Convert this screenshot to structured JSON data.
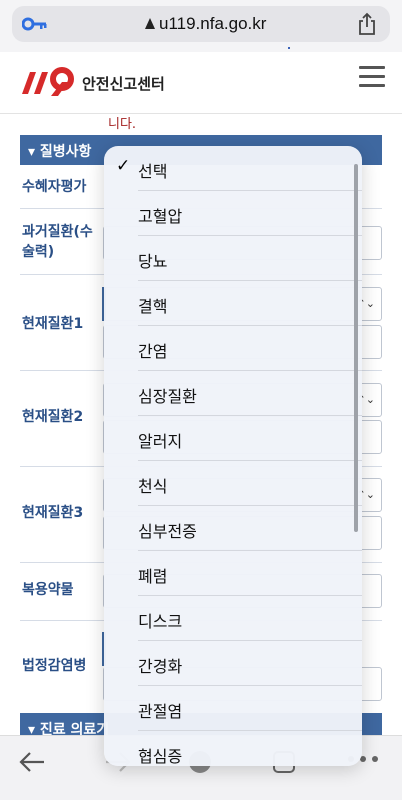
{
  "browser": {
    "url": "u119.nfa.go.kr"
  },
  "site": {
    "brand": "안전신고센터"
  },
  "page": {
    "warning_fragment": "니다.",
    "section_1": "질병사항",
    "section_2": "진료 의료기",
    "rows": [
      {
        "label": "수혜자평가"
      },
      {
        "label": "과거질환(수\n술력)"
      },
      {
        "label": "현재질환1"
      },
      {
        "label": "현재질환2"
      },
      {
        "label": "현재질환3"
      },
      {
        "label": "복용약물"
      },
      {
        "label": "법정감염병"
      }
    ]
  },
  "dropdown": {
    "selected": "선택",
    "options": [
      "선택",
      "고혈압",
      "당뇨",
      "결핵",
      "간염",
      "심장질환",
      "알러지",
      "천식",
      "심부전증",
      "폐렴",
      "디스크",
      "간경화",
      "관절염",
      "협심증"
    ]
  }
}
